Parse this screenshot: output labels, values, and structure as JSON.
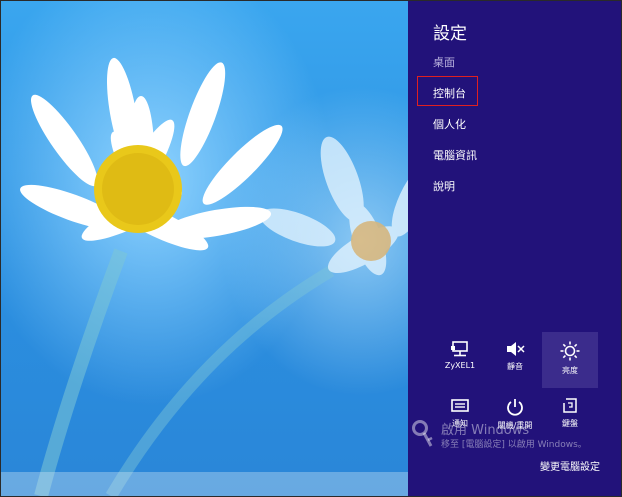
{
  "settings": {
    "title": "設定",
    "items": [
      {
        "label": "桌面",
        "muted": true
      },
      {
        "label": "控制台",
        "muted": false,
        "highlighted": true
      },
      {
        "label": "個人化",
        "muted": false
      },
      {
        "label": "電腦資訊",
        "muted": false
      },
      {
        "label": "說明",
        "muted": false
      }
    ]
  },
  "quick_settings": {
    "row1": [
      {
        "label": "ZyXEL1",
        "icon": "network-monitor-icon"
      },
      {
        "label": "靜音",
        "icon": "speaker-mute-icon"
      },
      {
        "label": "亮度",
        "icon": "brightness-sun-icon",
        "active": true
      }
    ],
    "row2": [
      {
        "label": "通知",
        "icon": "notifications-icon"
      },
      {
        "label": "關機/重開",
        "icon": "power-icon"
      },
      {
        "label": "鍵盤",
        "icon": "keyboard-icon"
      }
    ]
  },
  "change_pc_settings": "變更電腦設定",
  "watermark": {
    "line1": "啟用 Windows",
    "line2": "移至 [電腦設定] 以啟用 Windows。"
  },
  "colors": {
    "charms_bg": "#22127a",
    "highlight_border": "#e02020",
    "wallpaper": "#2b8fe0"
  }
}
